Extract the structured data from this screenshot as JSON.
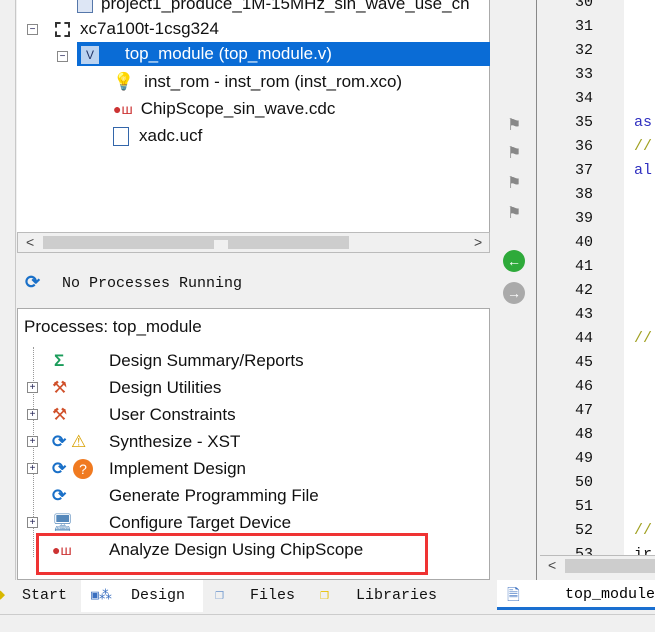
{
  "tree": {
    "items": [
      {
        "label": "project1_produce_1M-15MHz_sin_wave_use_ch",
        "icon": "project-icon"
      },
      {
        "label": "xc7a100t-1csg324",
        "icon": "chip-icon"
      },
      {
        "label": "top_module (top_module.v)",
        "icon": "verilog-module-icon",
        "selected": true
      },
      {
        "label": "inst_rom - inst_rom (inst_rom.xco)",
        "icon": "ip-core-icon"
      },
      {
        "label": "ChipScope_sin_wave.cdc",
        "icon": "chipscope-icon"
      },
      {
        "label": "xadc.ucf",
        "icon": "ucf-file-icon"
      }
    ]
  },
  "process_status": "No Processes Running",
  "processes": {
    "title": "Processes: top_module",
    "items": [
      {
        "label": "Design Summary/Reports",
        "expandable": false
      },
      {
        "label": "Design Utilities",
        "expandable": true
      },
      {
        "label": "User Constraints",
        "expandable": true
      },
      {
        "label": "Synthesize - XST",
        "expandable": true,
        "status": "warning"
      },
      {
        "label": "Implement Design",
        "expandable": true,
        "status": "unknown"
      },
      {
        "label": "Generate Programming File",
        "expandable": false
      },
      {
        "label": "Configure Target Device",
        "expandable": true
      },
      {
        "label": "Analyze Design Using ChipScope",
        "expandable": false,
        "highlighted": true
      }
    ]
  },
  "tabs": [
    {
      "label": "Start"
    },
    {
      "label": "Design",
      "active": true
    },
    {
      "label": "Files"
    },
    {
      "label": "Libraries"
    }
  ],
  "editor": {
    "line_numbers": [
      "30",
      "31",
      "32",
      "33",
      "34",
      "35",
      "36",
      "37",
      "38",
      "39",
      "40",
      "41",
      "42",
      "43",
      "44",
      "45",
      "46",
      "47",
      "48",
      "49",
      "50",
      "51",
      "52",
      "53"
    ],
    "code_fragments": [
      {
        "line": "35",
        "text": "as",
        "color": "#3030c0"
      },
      {
        "line": "36",
        "text": "//",
        "color": "#a0a020"
      },
      {
        "line": "37",
        "text": "al",
        "color": "#3030c0"
      },
      {
        "line": "44",
        "text": "//",
        "color": "#a0a020"
      },
      {
        "line": "52",
        "text": "//",
        "color": "#a0a020"
      },
      {
        "line": "53",
        "text": "ir",
        "color": "#111111"
      }
    ],
    "tab_label": "top_module"
  },
  "colors": {
    "selection": "#0a6cd6",
    "highlight_box": "#ef3333"
  }
}
